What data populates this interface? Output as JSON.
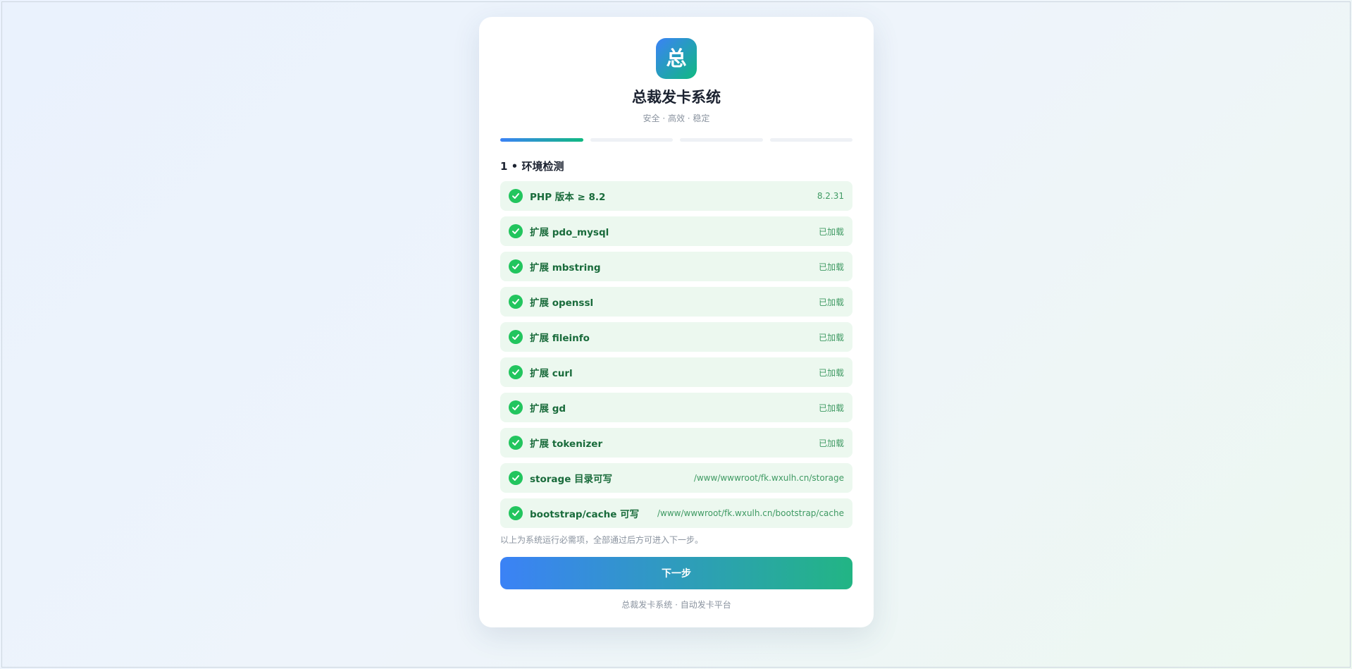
{
  "header": {
    "logo_char": "总",
    "title": "总裁发卡系统",
    "subtitle": "安全 · 高效 · 稳定"
  },
  "progress": {
    "total_steps": 4,
    "current_step": 1
  },
  "step_title": "1 • 环境检测",
  "checks": [
    {
      "label": "PHP 版本 ≥ 8.2",
      "value": "8.2.31",
      "status": "ok"
    },
    {
      "label": "扩展 pdo_mysql",
      "value": "已加载",
      "status": "ok"
    },
    {
      "label": "扩展 mbstring",
      "value": "已加载",
      "status": "ok"
    },
    {
      "label": "扩展 openssl",
      "value": "已加载",
      "status": "ok"
    },
    {
      "label": "扩展 fileinfo",
      "value": "已加载",
      "status": "ok"
    },
    {
      "label": "扩展 curl",
      "value": "已加载",
      "status": "ok"
    },
    {
      "label": "扩展 gd",
      "value": "已加载",
      "status": "ok"
    },
    {
      "label": "扩展 tokenizer",
      "value": "已加载",
      "status": "ok"
    },
    {
      "label": "storage 目录可写",
      "value": "/www/wwwroot/fk.wxulh.cn/storage",
      "status": "ok"
    },
    {
      "label": "bootstrap/cache 可写",
      "value": "/www/wwwroot/fk.wxulh.cn/bootstrap/cache",
      "status": "ok"
    }
  ],
  "note": "以上为系统运行必需项，全部通过后方可进入下一步。",
  "next_button": "下一步",
  "footer": "总裁发卡系统 · 自动发卡平台",
  "colors": {
    "accent_start": "#3b82f6",
    "accent_end": "#10b981",
    "ok_green": "#22c55e",
    "ok_bg": "#ecf8ef"
  }
}
